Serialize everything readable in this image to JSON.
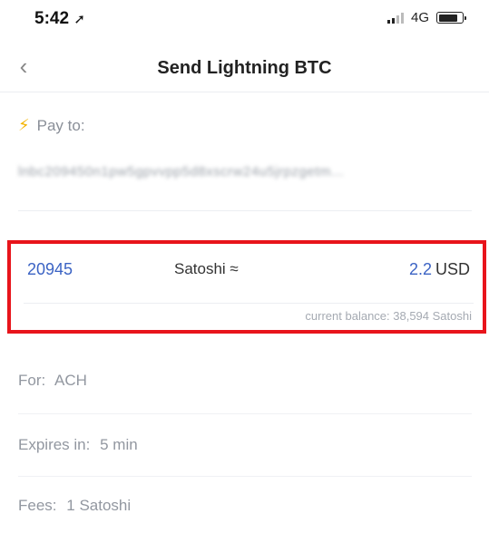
{
  "status": {
    "time": "5:42",
    "network": "4G"
  },
  "nav": {
    "back_icon": "‹",
    "title": "Send Lightning BTC"
  },
  "pay": {
    "label": "Pay to:",
    "address": "lnbc209450n1pw5gpvvpp5d8xscrw24u5jrpzgetm..."
  },
  "amount": {
    "value": "20945",
    "unit": "Satoshi ≈",
    "fiat_value": "2.2",
    "fiat_unit": "USD",
    "balance": "current balance: 38,594 Satoshi"
  },
  "details": {
    "for_label": "For:",
    "for_value": "ACH",
    "expires_label": "Expires in:",
    "expires_value": "5 min",
    "fees_label": "Fees:",
    "fees_value": "1 Satoshi"
  },
  "colors": {
    "accent": "#3b63c4",
    "highlight": "#e8141b",
    "bolt": "#f4b400"
  }
}
